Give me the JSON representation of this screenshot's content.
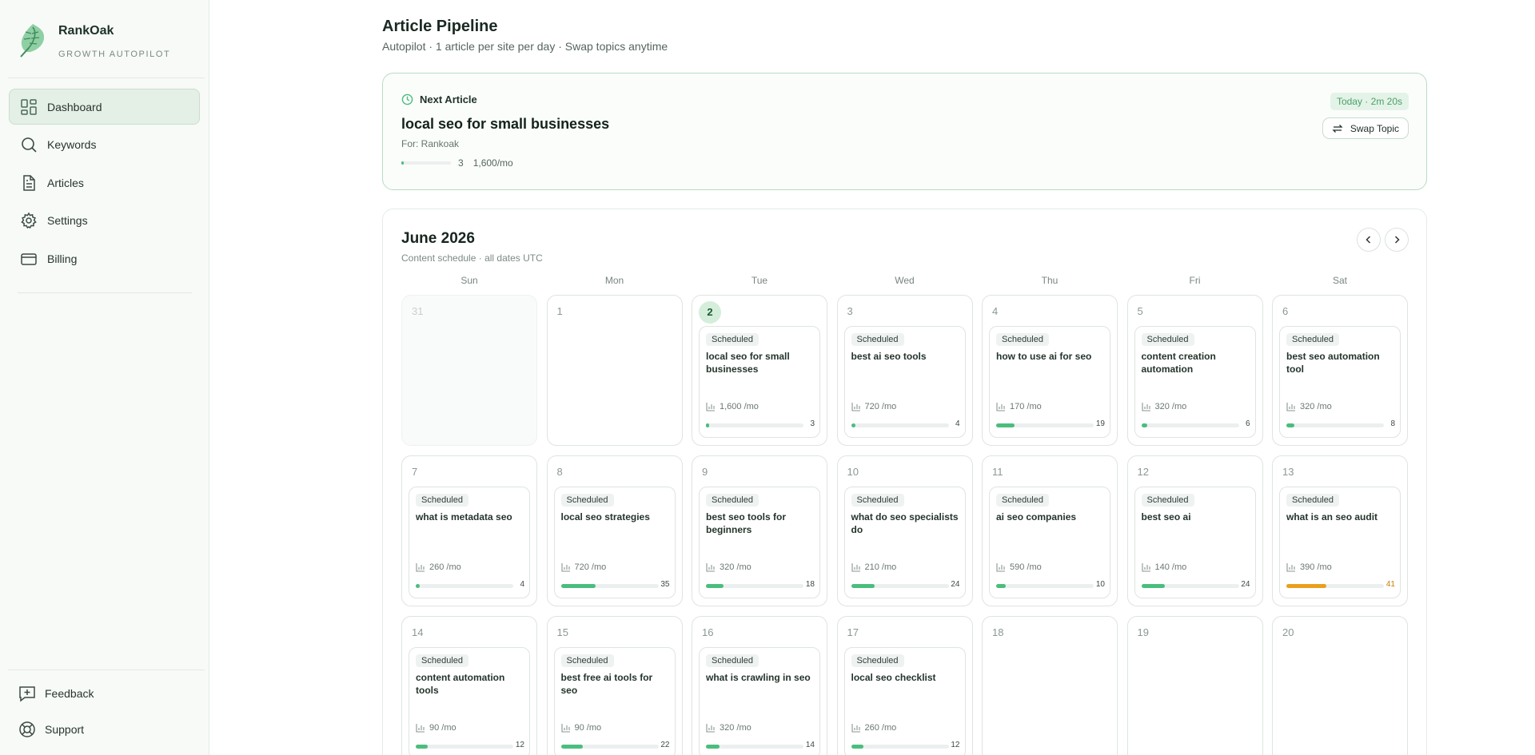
{
  "brand": {
    "name": "RankOak",
    "tagline": "GROWTH AUTOPILOT"
  },
  "sidebar": {
    "items": [
      {
        "label": "Dashboard",
        "icon": "dashboard-icon",
        "active": true
      },
      {
        "label": "Keywords",
        "icon": "search-icon",
        "active": false
      },
      {
        "label": "Articles",
        "icon": "document-icon",
        "active": false
      },
      {
        "label": "Settings",
        "icon": "gear-icon",
        "active": false
      },
      {
        "label": "Billing",
        "icon": "credit-card-icon",
        "active": false
      }
    ],
    "bottom": [
      {
        "label": "Feedback",
        "icon": "feedback-icon"
      },
      {
        "label": "Support",
        "icon": "lifebuoy-icon"
      }
    ]
  },
  "header": {
    "title": "Article Pipeline",
    "subtitle": "Autopilot · 1 article per site per day · Swap topics anytime"
  },
  "next_article": {
    "label": "Next Article",
    "topic": "local seo for small businesses",
    "site": "For: Rankoak",
    "difficulty": "3",
    "volume": "1,600/mo",
    "eta": "Today · 2m 20s",
    "swap_label": "Swap Topic"
  },
  "calendar": {
    "month": "June 2026",
    "subtitle": "Content schedule · all dates UTC",
    "weekdays": [
      "Sun",
      "Mon",
      "Tue",
      "Wed",
      "Thu",
      "Fri",
      "Sat"
    ],
    "days": [
      {
        "num": "31",
        "muted": true
      },
      {
        "num": "1"
      },
      {
        "num": "2",
        "today": true,
        "article": {
          "status": "Scheduled",
          "title": "local seo for small businesses",
          "volume": "1,600 /mo",
          "kd": "3"
        }
      },
      {
        "num": "3",
        "article": {
          "status": "Scheduled",
          "title": "best ai seo tools",
          "volume": "720 /mo",
          "kd": "4"
        }
      },
      {
        "num": "4",
        "article": {
          "status": "Scheduled",
          "title": "how to use ai for seo",
          "volume": "170 /mo",
          "kd": "19"
        }
      },
      {
        "num": "5",
        "article": {
          "status": "Scheduled",
          "title": "content creation automation",
          "volume": "320 /mo",
          "kd": "6"
        }
      },
      {
        "num": "6",
        "article": {
          "status": "Scheduled",
          "title": "best seo automation tool",
          "volume": "320 /mo",
          "kd": "8"
        }
      },
      {
        "num": "7",
        "article": {
          "status": "Scheduled",
          "title": "what is metadata seo",
          "volume": "260 /mo",
          "kd": "4"
        }
      },
      {
        "num": "8",
        "article": {
          "status": "Scheduled",
          "title": "local seo strategies",
          "volume": "720 /mo",
          "kd": "35"
        }
      },
      {
        "num": "9",
        "article": {
          "status": "Scheduled",
          "title": "best seo tools for beginners",
          "volume": "320 /mo",
          "kd": "18"
        }
      },
      {
        "num": "10",
        "article": {
          "status": "Scheduled",
          "title": "what do seo specialists do",
          "volume": "210 /mo",
          "kd": "24"
        }
      },
      {
        "num": "11",
        "article": {
          "status": "Scheduled",
          "title": "ai seo companies",
          "volume": "590 /mo",
          "kd": "10"
        }
      },
      {
        "num": "12",
        "article": {
          "status": "Scheduled",
          "title": "best seo ai",
          "volume": "140 /mo",
          "kd": "24"
        }
      },
      {
        "num": "13",
        "article": {
          "status": "Scheduled",
          "title": "what is an seo audit",
          "volume": "390 /mo",
          "kd": "41"
        }
      },
      {
        "num": "14",
        "article": {
          "status": "Scheduled",
          "title": "content automation tools",
          "volume": "90 /mo",
          "kd": "12"
        }
      },
      {
        "num": "15",
        "article": {
          "status": "Scheduled",
          "title": "best free ai tools for seo",
          "volume": "90 /mo",
          "kd": "22"
        }
      },
      {
        "num": "16",
        "article": {
          "status": "Scheduled",
          "title": "what is crawling in seo",
          "volume": "320 /mo",
          "kd": "14"
        }
      },
      {
        "num": "17",
        "article": {
          "status": "Scheduled",
          "title": "local seo checklist",
          "volume": "260 /mo",
          "kd": "12"
        }
      },
      {
        "num": "18"
      },
      {
        "num": "19"
      },
      {
        "num": "20"
      }
    ]
  },
  "colors": {
    "accent": "#4bbd7e",
    "warning": "#e9a01c",
    "brand_dark": "#1d3127"
  }
}
